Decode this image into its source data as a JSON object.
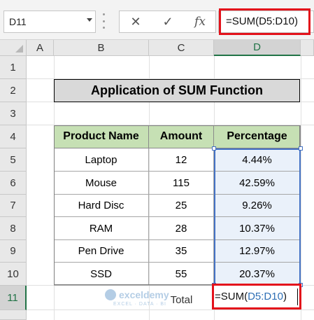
{
  "formula_bar": {
    "name_box": "D11",
    "cancel_symbol": "✕",
    "enter_symbol": "✓",
    "fx_symbol": "fx",
    "formula": "=SUM(D5:D10)"
  },
  "columns": [
    "A",
    "B",
    "C",
    "D"
  ],
  "rows": [
    "1",
    "2",
    "3",
    "4",
    "5",
    "6",
    "7",
    "8",
    "9",
    "10",
    "11"
  ],
  "title": "Application of SUM Function",
  "table": {
    "headers": [
      "Product Name",
      "Amount",
      "Percentage"
    ],
    "rows": [
      [
        "Laptop",
        "12",
        "4.44%"
      ],
      [
        "Mouse",
        "115",
        "42.59%"
      ],
      [
        "Hard Disc",
        "25",
        "9.26%"
      ],
      [
        "RAM",
        "28",
        "10.37%"
      ],
      [
        "Pen Drive",
        "35",
        "12.97%"
      ],
      [
        "SSD",
        "55",
        "20.37%"
      ]
    ],
    "total_label": "Total",
    "total_formula_prefix": "=SUM(",
    "total_formula_ref": "D5:D10",
    "total_formula_suffix": ")"
  },
  "watermark": {
    "name": "exceldemy",
    "tagline": "EXCEL · DATA · BI"
  },
  "colors": {
    "header_fill": "#c6e0b4",
    "title_fill": "#d9d9d9",
    "selection": "#4472c4",
    "highlight": "#e3121b",
    "excel_green": "#217346"
  }
}
